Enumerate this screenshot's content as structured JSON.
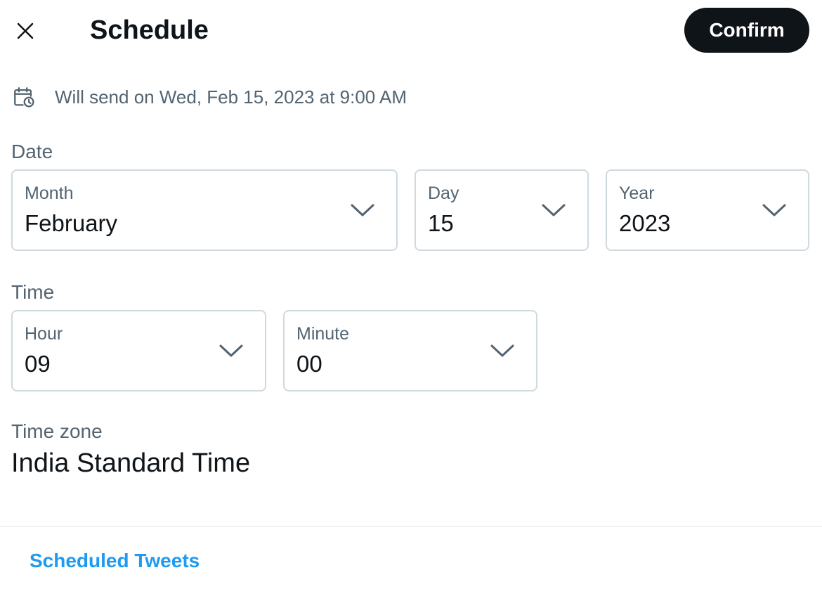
{
  "header": {
    "title": "Schedule",
    "confirm_label": "Confirm",
    "close_icon": "close-icon"
  },
  "send_info": {
    "icon": "calendar-clock-icon",
    "text": "Will send on Wed, Feb 15, 2023 at 9:00 AM"
  },
  "date": {
    "label": "Date",
    "month": {
      "label": "Month",
      "value": "February"
    },
    "day": {
      "label": "Day",
      "value": "15"
    },
    "year": {
      "label": "Year",
      "value": "2023"
    }
  },
  "time": {
    "label": "Time",
    "hour": {
      "label": "Hour",
      "value": "09"
    },
    "minute": {
      "label": "Minute",
      "value": "00"
    }
  },
  "timezone": {
    "label": "Time zone",
    "value": "India Standard Time"
  },
  "footer": {
    "scheduled_link": "Scheduled Tweets"
  },
  "colors": {
    "primary_text": "#0f1419",
    "secondary_text": "#536471",
    "border": "#cfd9de",
    "link": "#1d9bf0",
    "button_bg": "#0f1419"
  }
}
